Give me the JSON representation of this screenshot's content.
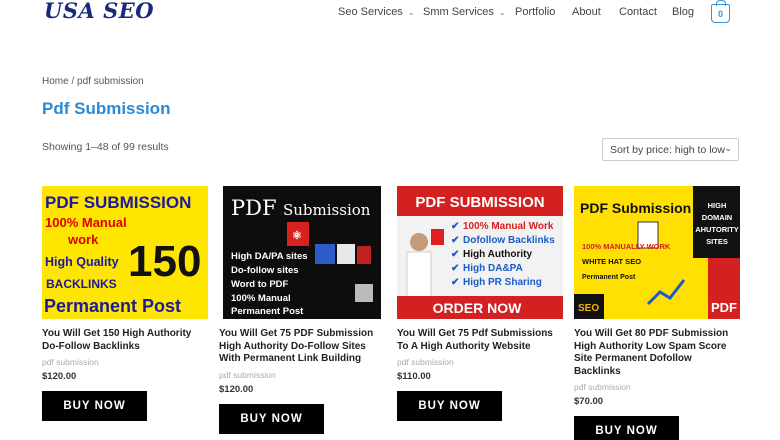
{
  "header": {
    "logo": "USA SEO",
    "nav": [
      {
        "label": "Seo Services",
        "dropdown": true
      },
      {
        "label": "Smm Services",
        "dropdown": true
      },
      {
        "label": "Portfolio",
        "dropdown": false
      },
      {
        "label": "About",
        "dropdown": false
      },
      {
        "label": "Contact",
        "dropdown": false
      },
      {
        "label": "Blog",
        "dropdown": false
      }
    ],
    "cart_count": "0"
  },
  "breadcrumb": "Home / pdf submission",
  "page_title": "Pdf Submission",
  "result_count": "Showing 1–48 of 99 results",
  "sort": {
    "selected": "Sort by price: high to low"
  },
  "colors": {
    "accent": "#2a8ad6",
    "button": "#000000",
    "logo": "#1a2a7a"
  },
  "products": [
    {
      "title": "You Will Get 150 High Authority Do-Follow Backlinks",
      "category": "pdf submission",
      "price": "$120.00",
      "button": "BUY NOW",
      "image_text": {
        "line1": "PDF SUBMISSION",
        "line2": "100% Manual",
        "line3": "work",
        "line4": "High Quality",
        "number": "150",
        "line5": "BACKLINKS",
        "line6": "Permanent Post"
      }
    },
    {
      "title": "You Will Get 75 PDF Submission High Authority Do-Follow Sites With Permanent Link Building",
      "category": "pdf submission",
      "price": "$120.00",
      "button": "BUY NOW",
      "image_text": {
        "head1": "PDF",
        "head2": "Submission",
        "items": [
          "High DA/PA sites",
          "Do-follow sites",
          "Word to PDF",
          "100% Manual",
          "Permanent Post"
        ]
      }
    },
    {
      "title": "You Will Get 75 Pdf Submissions To A High Authority Website",
      "category": "pdf submission",
      "price": "$110.00",
      "button": "BUY NOW",
      "image_text": {
        "head": "PDF SUBMISSION",
        "items": [
          "100% Manual Work",
          "Dofollow Backlinks",
          "High Authority",
          "High DA&PA",
          "High PR Sharing"
        ],
        "cta": "ORDER NOW"
      }
    },
    {
      "title": "You Will Get 80 PDF Submission High Authority Low Spam Score Site Permanent Dofollow Backlinks",
      "category": "pdf submission",
      "price": "$70.00",
      "button": "BUY NOW",
      "image_text": {
        "head": "PDF Submission",
        "side": [
          "HIGH",
          "DOMAIN",
          "AHUTORITY",
          "SITES"
        ],
        "l1": "100% MANUALLY WORK",
        "l2": "WHITE HAT SEO",
        "l3": "Permanent Post",
        "seo": "SEO",
        "pdf": "PDF"
      }
    }
  ]
}
